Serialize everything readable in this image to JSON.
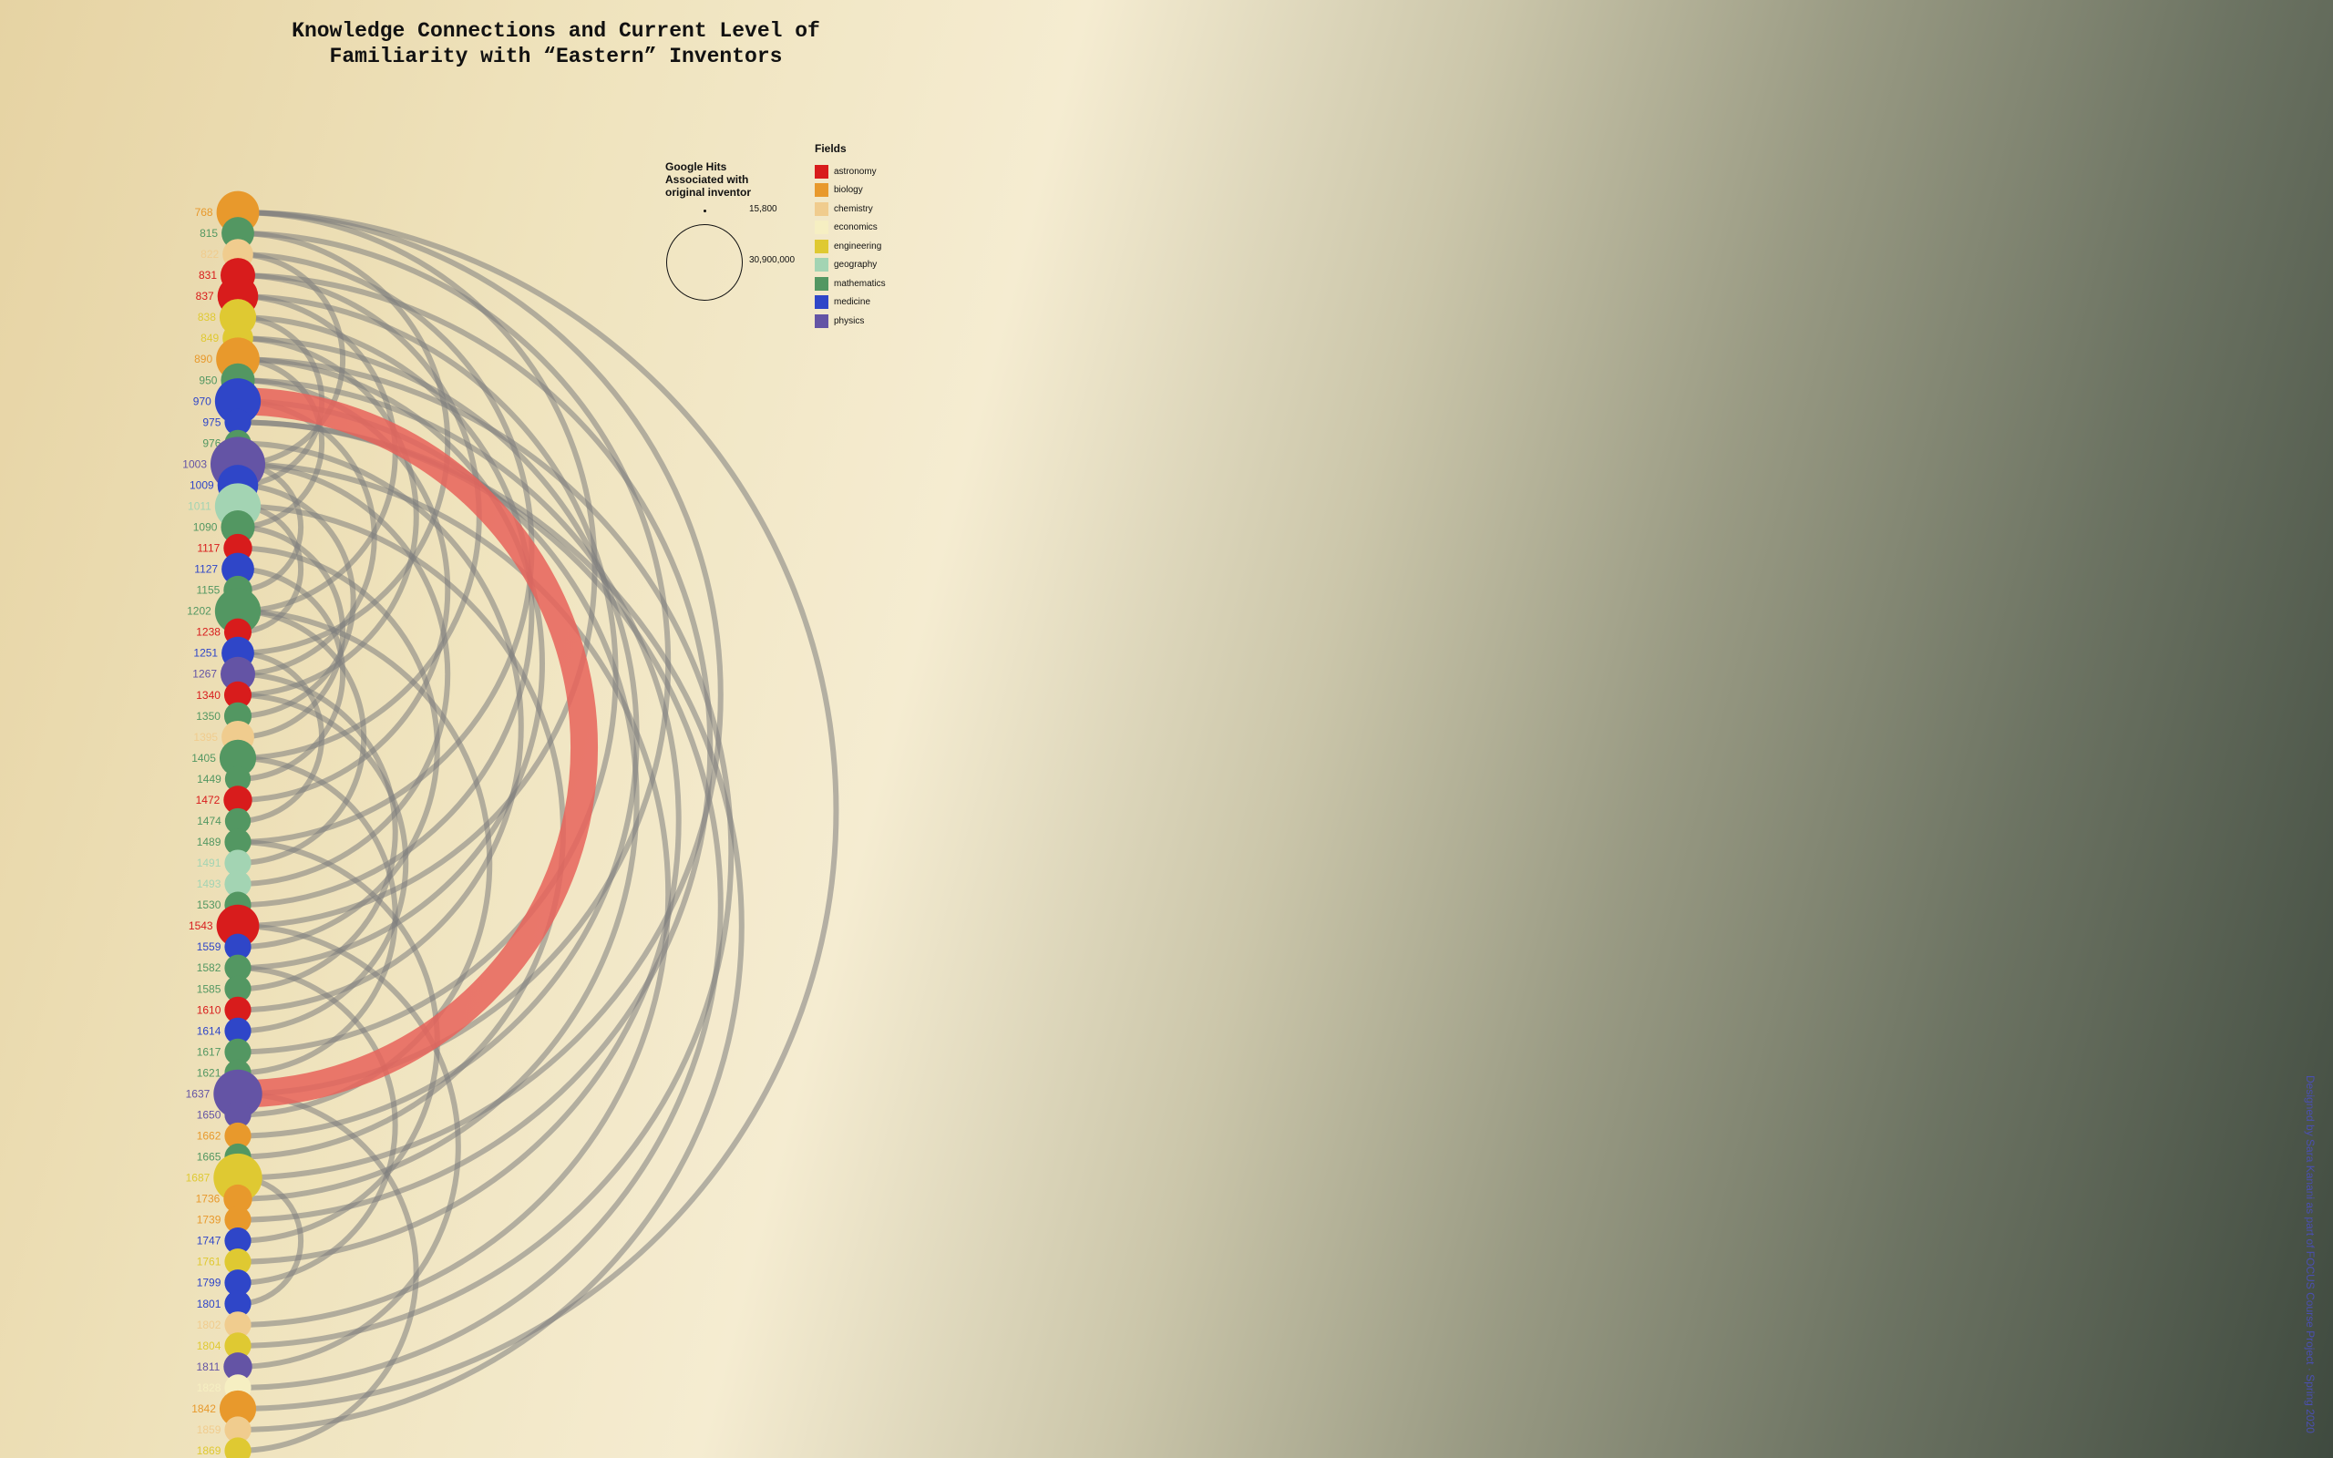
{
  "title": {
    "line1": "Knowledge Connections and Current Level of",
    "line2": "Familiarity with “Eastern” Inventors"
  },
  "size_legend": {
    "title": "Google Hits Associated with original inventor",
    "min_label": "15,800",
    "max_label": "30,900,000"
  },
  "fields_legend": {
    "title": "Fields",
    "items": [
      {
        "name": "astronomy",
        "color": "#d81c1c"
      },
      {
        "name": "biology",
        "color": "#e8992c"
      },
      {
        "name": "chemistry",
        "color": "#f0cc8e"
      },
      {
        "name": "economics",
        "color": "#f6efc2"
      },
      {
        "name": "engineering",
        "color": "#dfc932"
      },
      {
        "name": "geography",
        "color": "#a3d4b3"
      },
      {
        "name": "mathematics",
        "color": "#539762"
      },
      {
        "name": "medicine",
        "color": "#2f46c8"
      },
      {
        "name": "physics",
        "color": "#6454a5"
      }
    ]
  },
  "credit": "Designed by Sara Kanani as part of FOCUS Course Project · Spring 2020",
  "chart_data": {
    "type": "arc-diagram",
    "nodes": [
      {
        "year": "768",
        "field": "biology",
        "size": 0.7
      },
      {
        "year": "815",
        "field": "mathematics",
        "size": 0.45
      },
      {
        "year": "822",
        "field": "chemistry",
        "size": 0.4
      },
      {
        "year": "831",
        "field": "astronomy",
        "size": 0.5
      },
      {
        "year": "837",
        "field": "astronomy",
        "size": 0.65
      },
      {
        "year": "838",
        "field": "engineering",
        "size": 0.55
      },
      {
        "year": "849",
        "field": "engineering",
        "size": 0.4
      },
      {
        "year": "890",
        "field": "biology",
        "size": 0.72
      },
      {
        "year": "950",
        "field": "mathematics",
        "size": 0.48
      },
      {
        "year": "970",
        "field": "medicine",
        "size": 0.78
      },
      {
        "year": "975",
        "field": "medicine",
        "size": 0.3
      },
      {
        "year": "976",
        "field": "mathematics",
        "size": 0.3
      },
      {
        "year": "1003",
        "field": "physics",
        "size": 1.0
      },
      {
        "year": "1009",
        "field": "medicine",
        "size": 0.65
      },
      {
        "year": "1011",
        "field": "geography",
        "size": 0.78
      },
      {
        "year": "1090",
        "field": "mathematics",
        "size": 0.48
      },
      {
        "year": "1117",
        "field": "astronomy",
        "size": 0.35
      },
      {
        "year": "1127",
        "field": "medicine",
        "size": 0.45
      },
      {
        "year": "1155",
        "field": "mathematics",
        "size": 0.35
      },
      {
        "year": "1202",
        "field": "mathematics",
        "size": 0.78
      },
      {
        "year": "1238",
        "field": "astronomy",
        "size": 0.32
      },
      {
        "year": "1251",
        "field": "medicine",
        "size": 0.45
      },
      {
        "year": "1267",
        "field": "physics",
        "size": 0.5
      },
      {
        "year": "1340",
        "field": "astronomy",
        "size": 0.32
      },
      {
        "year": "1350",
        "field": "mathematics",
        "size": 0.32
      },
      {
        "year": "1395",
        "field": "chemistry",
        "size": 0.45
      },
      {
        "year": "1405",
        "field": "mathematics",
        "size": 0.55
      },
      {
        "year": "1449",
        "field": "mathematics",
        "size": 0.28
      },
      {
        "year": "1472",
        "field": "astronomy",
        "size": 0.35
      },
      {
        "year": "1474",
        "field": "mathematics",
        "size": 0.28
      },
      {
        "year": "1489",
        "field": "mathematics",
        "size": 0.3
      },
      {
        "year": "1491",
        "field": "geography",
        "size": 0.3
      },
      {
        "year": "1493",
        "field": "geography",
        "size": 0.3
      },
      {
        "year": "1530",
        "field": "mathematics",
        "size": 0.3
      },
      {
        "year": "1543",
        "field": "astronomy",
        "size": 0.7
      },
      {
        "year": "1559",
        "field": "medicine",
        "size": 0.3
      },
      {
        "year": "1582",
        "field": "mathematics",
        "size": 0.3
      },
      {
        "year": "1585",
        "field": "mathematics",
        "size": 0.3
      },
      {
        "year": "1610",
        "field": "astronomy",
        "size": 0.3
      },
      {
        "year": "1614",
        "field": "medicine",
        "size": 0.3
      },
      {
        "year": "1617",
        "field": "mathematics",
        "size": 0.3
      },
      {
        "year": "1621",
        "field": "mathematics",
        "size": 0.3
      },
      {
        "year": "1637",
        "field": "physics",
        "size": 0.85
      },
      {
        "year": "1650",
        "field": "physics",
        "size": 0.3
      },
      {
        "year": "1662",
        "field": "biology",
        "size": 0.3
      },
      {
        "year": "1665",
        "field": "mathematics",
        "size": 0.3
      },
      {
        "year": "1687",
        "field": "engineering",
        "size": 0.85
      },
      {
        "year": "1736",
        "field": "biology",
        "size": 0.35
      },
      {
        "year": "1739",
        "field": "biology",
        "size": 0.3
      },
      {
        "year": "1747",
        "field": "medicine",
        "size": 0.3
      },
      {
        "year": "1761",
        "field": "engineering",
        "size": 0.3
      },
      {
        "year": "1799",
        "field": "medicine",
        "size": 0.3
      },
      {
        "year": "1801",
        "field": "medicine",
        "size": 0.3
      },
      {
        "year": "1802",
        "field": "chemistry",
        "size": 0.3
      },
      {
        "year": "1804",
        "field": "engineering",
        "size": 0.3
      },
      {
        "year": "1811",
        "field": "physics",
        "size": 0.35
      },
      {
        "year": "1828",
        "field": "economics",
        "size": 0.3
      },
      {
        "year": "1842",
        "field": "biology",
        "size": 0.55
      },
      {
        "year": "1859",
        "field": "chemistry",
        "size": 0.3
      },
      {
        "year": "1869",
        "field": "engineering",
        "size": 0.3
      }
    ],
    "links": [
      [
        0,
        34
      ],
      [
        0,
        46
      ],
      [
        0,
        57
      ],
      [
        1,
        21
      ],
      [
        1,
        42
      ],
      [
        2,
        12
      ],
      [
        2,
        30
      ],
      [
        3,
        26
      ],
      [
        3,
        48
      ],
      [
        4,
        19
      ],
      [
        4,
        40
      ],
      [
        5,
        13
      ],
      [
        5,
        33
      ],
      [
        6,
        44
      ],
      [
        7,
        15
      ],
      [
        7,
        36
      ],
      [
        7,
        54
      ],
      [
        8,
        28
      ],
      [
        8,
        50
      ],
      [
        9,
        22
      ],
      [
        9,
        47
      ],
      [
        10,
        58
      ],
      [
        11,
        38
      ],
      [
        12,
        18
      ],
      [
        12,
        32
      ],
      [
        12,
        53
      ],
      [
        13,
        24
      ],
      [
        14,
        20
      ],
      [
        14,
        45
      ],
      [
        15,
        25
      ],
      [
        16,
        35
      ],
      [
        17,
        27
      ],
      [
        19,
        31
      ],
      [
        19,
        43
      ],
      [
        21,
        29
      ],
      [
        22,
        37
      ],
      [
        23,
        39
      ],
      [
        26,
        41
      ],
      [
        30,
        49
      ],
      [
        34,
        55
      ],
      [
        36,
        51
      ],
      [
        42,
        59
      ],
      [
        46,
        52
      ],
      [
        10,
        56
      ],
      [
        6,
        23
      ]
    ],
    "highlight_link": [
      9,
      42
    ]
  }
}
